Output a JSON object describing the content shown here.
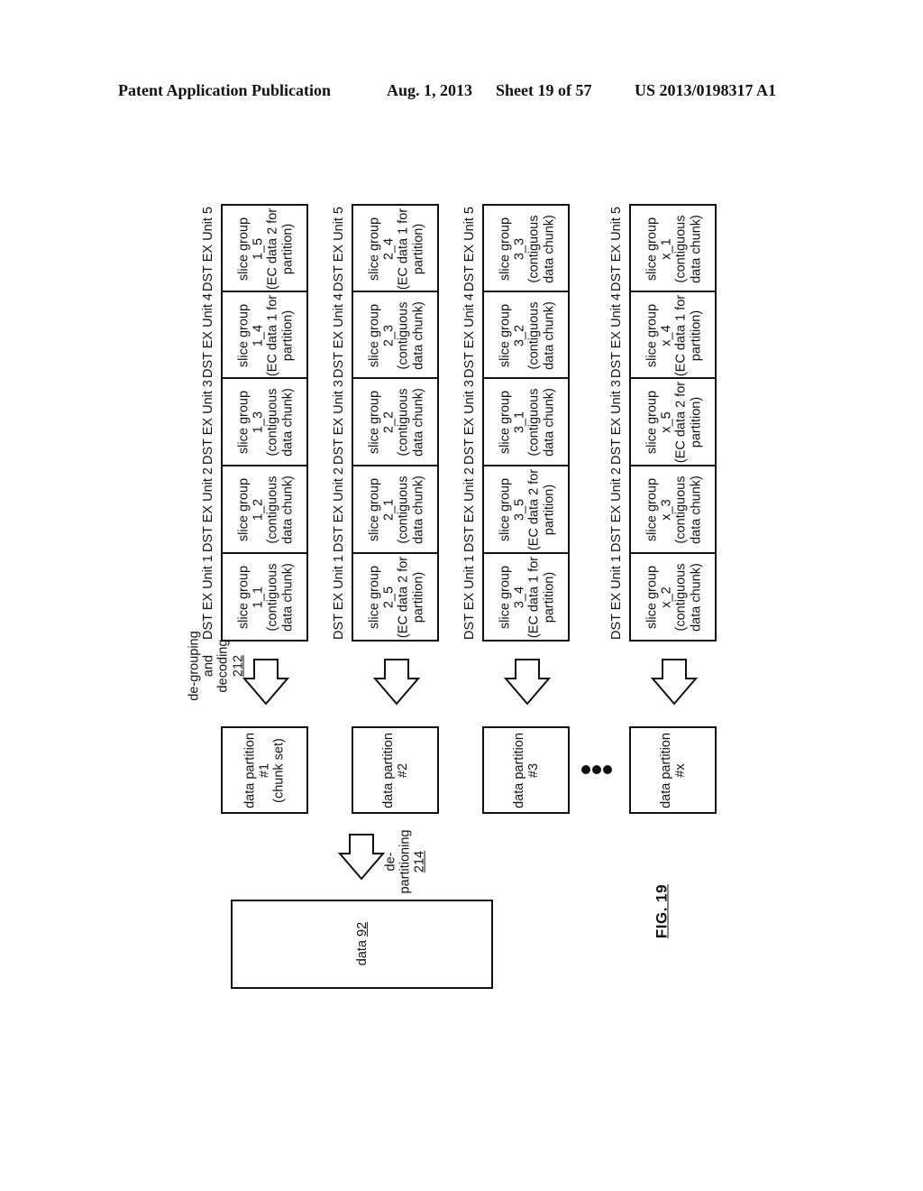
{
  "header": {
    "publication": "Patent Application Publication",
    "date": "Aug. 1, 2013",
    "sheet": "Sheet 19 of 57",
    "number": "US 2013/0198317 A1"
  },
  "unit_labels": [
    "DST EX Unit 1",
    "DST EX Unit 2",
    "DST EX Unit 3",
    "DST EX Unit 4",
    "DST EX Unit 5"
  ],
  "rows": [
    {
      "cells": [
        {
          "title": "slice group",
          "id": "1_1",
          "desc1": "(contiguous",
          "desc2": "data chunk)"
        },
        {
          "title": "slice group",
          "id": "1_2",
          "desc1": "(contiguous",
          "desc2": "data chunk)"
        },
        {
          "title": "slice group",
          "id": "1_3",
          "desc1": "(contiguous",
          "desc2": "data chunk)"
        },
        {
          "title": "slice group",
          "id": "1_4",
          "desc1": "(EC data 1 for",
          "desc2": "partition)"
        },
        {
          "title": "slice group",
          "id": "1_5",
          "desc1": "(EC data 2 for",
          "desc2": "partition)"
        }
      ],
      "partition": {
        "line1": "data partition",
        "line2": "#1",
        "line3": "(chunk set)"
      }
    },
    {
      "cells": [
        {
          "title": "slice group",
          "id": "2_5",
          "desc1": "(EC data 2 for",
          "desc2": "partition)"
        },
        {
          "title": "slice group",
          "id": "2_1",
          "desc1": "(contiguous",
          "desc2": "data chunk)"
        },
        {
          "title": "slice group",
          "id": "2_2",
          "desc1": "(contiguous",
          "desc2": "data chunk)"
        },
        {
          "title": "slice group",
          "id": "2_3",
          "desc1": "(contiguous",
          "desc2": "data chunk)"
        },
        {
          "title": "slice group",
          "id": "2_4",
          "desc1": "(EC data 1 for",
          "desc2": "partition)"
        }
      ],
      "partition": {
        "line1": "data partition",
        "line2": "#2",
        "line3": ""
      }
    },
    {
      "cells": [
        {
          "title": "slice group",
          "id": "3_4",
          "desc1": "(EC data 1 for",
          "desc2": "partition)"
        },
        {
          "title": "slice group",
          "id": "3_5",
          "desc1": "(EC data 2 for",
          "desc2": "partition)"
        },
        {
          "title": "slice group",
          "id": "3_1",
          "desc1": "(contiguous",
          "desc2": "data chunk)"
        },
        {
          "title": "slice group",
          "id": "3_2",
          "desc1": "(contiguous",
          "desc2": "data chunk)"
        },
        {
          "title": "slice group",
          "id": "3_3",
          "desc1": "(contiguous",
          "desc2": "data chunk)"
        }
      ],
      "partition": {
        "line1": "data partition",
        "line2": "#3",
        "line3": ""
      }
    },
    {
      "cells": [
        {
          "title": "slice group",
          "id": "x_2",
          "desc1": "(contiguous",
          "desc2": "data chunk)"
        },
        {
          "title": "slice group",
          "id": "x_3",
          "desc1": "(contiguous",
          "desc2": "data chunk)"
        },
        {
          "title": "slice group",
          "id": "x_5",
          "desc1": "(EC data 2 for",
          "desc2": "partition)"
        },
        {
          "title": "slice group",
          "id": "x_4",
          "desc1": "(EC data 1 for",
          "desc2": "partition)"
        },
        {
          "title": "slice group",
          "id": "x_1",
          "desc1": "(contiguous",
          "desc2": "data chunk)"
        }
      ],
      "partition": {
        "line1": "data partition",
        "line2": "#x",
        "line3": ""
      }
    }
  ],
  "degrouping": {
    "line1": "de-grouping",
    "line2": "and",
    "line3": "decoding",
    "ref": "212"
  },
  "departitioning": {
    "line1": "de-",
    "line2": "partitioning",
    "ref": "214"
  },
  "data_box": {
    "label": "data",
    "ref": "92"
  },
  "ellipsis": "•••",
  "figure_label": "FIG. 19"
}
